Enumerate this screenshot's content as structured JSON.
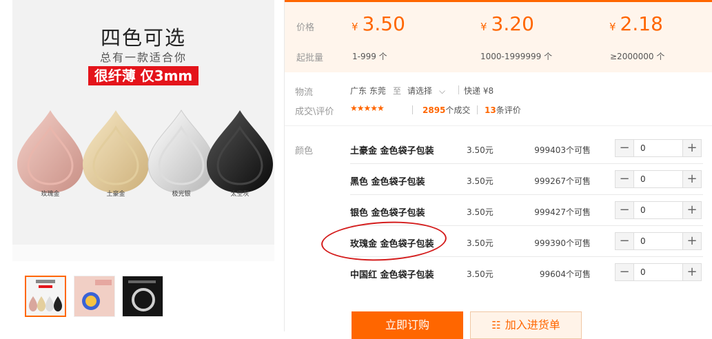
{
  "hero": {
    "title": "四色可选",
    "subtitle": "总有一款适合你",
    "badge": "很纤薄 仅3mm",
    "ring_labels": [
      "玫瑰金",
      "土豪金",
      "极光银",
      "太空灰"
    ]
  },
  "price_band": {
    "price_label": "价格",
    "moq_label": "起批量",
    "tiers": [
      {
        "currency": "¥",
        "price": "3.50",
        "range": "1-999 个"
      },
      {
        "currency": "¥",
        "price": "3.20",
        "range": "1000-1999999 个"
      },
      {
        "currency": "¥",
        "price": "2.18",
        "range": "≥2000000 个"
      }
    ]
  },
  "logistics": {
    "label": "物流",
    "origin": "广东 东莞",
    "to": "至",
    "destination": "请选择",
    "shipping": "快递 ¥8"
  },
  "reviews": {
    "label": "成交\\评价",
    "rating": 4.5,
    "deals_count": "2895",
    "deals_suffix": "个成交",
    "reviews_count": "13",
    "reviews_suffix": "条评价"
  },
  "colors": {
    "label": "颜色",
    "items": [
      {
        "name": "土豪金 金色袋子包装",
        "price": "3.50元",
        "stock": "999403个可售",
        "qty": "0"
      },
      {
        "name": "黑色 金色袋子包装",
        "price": "3.50元",
        "stock": "999267个可售",
        "qty": "0"
      },
      {
        "name": "银色 金色袋子包装",
        "price": "3.50元",
        "stock": "999427个可售",
        "qty": "0"
      },
      {
        "name": "玫瑰金 金色袋子包装",
        "price": "3.50元",
        "stock": "999390个可售",
        "qty": "0"
      },
      {
        "name": "中国红 金色袋子包装",
        "price": "3.50元",
        "stock": "99604个可售",
        "qty": "0"
      }
    ]
  },
  "stepper": {
    "minus": "−",
    "plus": "+"
  },
  "actions": {
    "order": "立即订购",
    "cart": "加入进货单"
  },
  "theme": {
    "accent": "#ff6600",
    "highlight": "#d41c1c"
  }
}
